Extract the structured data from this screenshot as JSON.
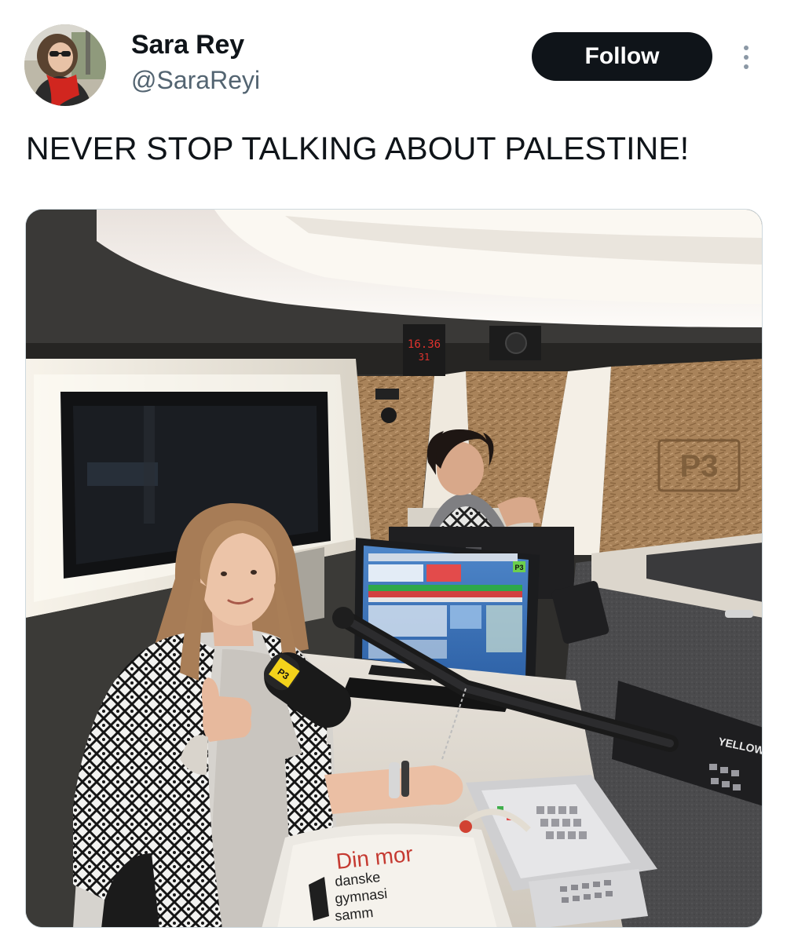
{
  "author": {
    "display_name": "Sara Rey",
    "handle": "@SaraReyi",
    "avatar_icon": "profile-photo"
  },
  "actions": {
    "follow_label": "Follow",
    "more_icon": "more-vertical-icon"
  },
  "tweet": {
    "text": "NEVER STOP TALKING ABOUT PALESTINE!"
  },
  "photo": {
    "clock_time": "16.36",
    "clock_seconds": "31",
    "wall_sign": "P3",
    "monitor_badge": "P3",
    "mic_label": "P3",
    "mic_arm_brand": "YELLOW",
    "bag_text_line1": "Din mor",
    "bag_text_line2": "danske",
    "bag_text_line3": "gymnasi",
    "bag_text_line4": "samm"
  },
  "colors": {
    "follow_bg": "#0f1419",
    "handle": "#536471",
    "text": "#0f1419"
  }
}
